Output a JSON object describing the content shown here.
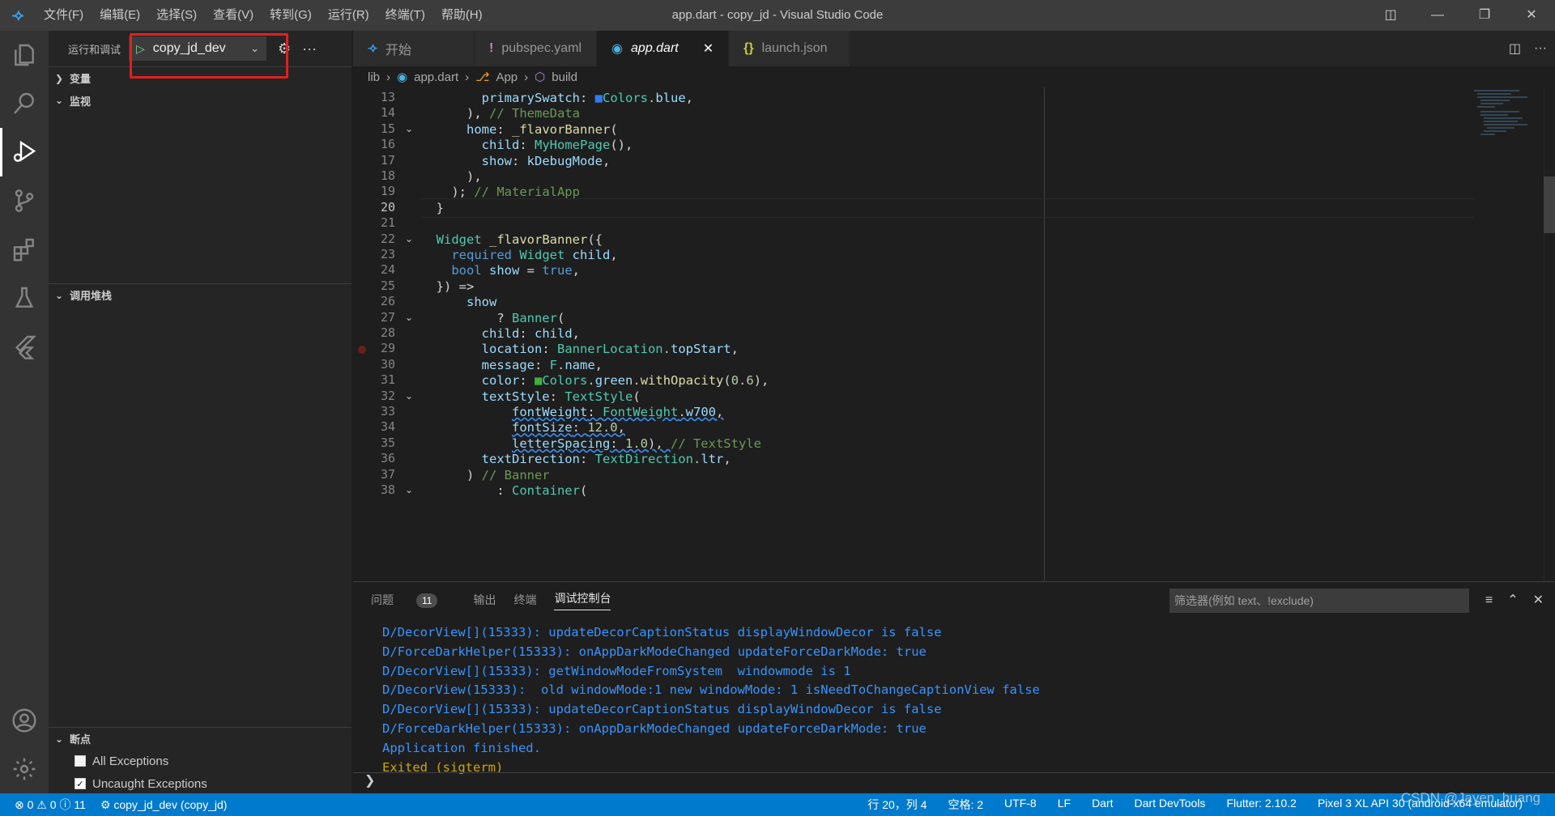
{
  "titlebar": {
    "menu": [
      "文件(F)",
      "编辑(E)",
      "选择(S)",
      "查看(V)",
      "转到(G)",
      "运行(R)",
      "终端(T)",
      "帮助(H)"
    ],
    "title": "app.dart - copy_jd - Visual Studio Code"
  },
  "sidebar": {
    "header": "运行和调试",
    "config": "copy_jd_dev",
    "sections": {
      "variables": "变量",
      "watch": "监视",
      "callstack": "调用堆栈",
      "breakpoints": "断点"
    },
    "exceptions": [
      {
        "label": "All Exceptions",
        "checked": false
      },
      {
        "label": "Uncaught Exceptions",
        "checked": true
      }
    ]
  },
  "tabs": [
    {
      "label": "开始",
      "icon": "vscode-logo-icon"
    },
    {
      "label": "pubspec.yaml",
      "icon": "exclamation-icon"
    },
    {
      "label": "app.dart",
      "icon": "dart-icon",
      "active": true
    },
    {
      "label": "launch.json",
      "icon": "braces-icon"
    }
  ],
  "breadcrumb": [
    "lib",
    "app.dart",
    "App",
    "build"
  ],
  "editor": {
    "current_line": 20,
    "breakpoint_line": 29,
    "lines": [
      {
        "n": 13,
        "segs": [
          [
            "        ",
            ""
          ],
          [
            "primarySwatch",
            ""
          ],
          [
            ": ",
            ""
          ],
          [
            "■",
            "#2f7bf2"
          ],
          [
            "Colors",
            ""
          ],
          [
            ".",
            ""
          ],
          [
            "blue",
            ""
          ],
          [
            ",",
            ""
          ]
        ]
      },
      {
        "n": 14,
        "segs": [
          [
            "      ), ",
            ""
          ],
          [
            "// ThemeData",
            "#6a9955"
          ]
        ]
      },
      {
        "n": 15,
        "segs": [
          [
            "      ",
            ""
          ],
          [
            "home",
            ""
          ],
          [
            ": ",
            ""
          ],
          [
            "_flavorBanner",
            ""
          ],
          [
            "(",
            ""
          ]
        ]
      },
      {
        "n": 16,
        "segs": [
          [
            "        ",
            ""
          ],
          [
            "child",
            ""
          ],
          [
            ": ",
            ""
          ],
          [
            "MyHomePage",
            ""
          ],
          [
            "(),",
            ""
          ]
        ]
      },
      {
        "n": 17,
        "segs": [
          [
            "        ",
            ""
          ],
          [
            "show",
            ""
          ],
          [
            ": ",
            ""
          ],
          [
            "kDebugMode",
            ""
          ],
          [
            ",",
            ""
          ]
        ]
      },
      {
        "n": 18,
        "segs": [
          [
            "      ),",
            ""
          ]
        ]
      },
      {
        "n": 19,
        "segs": [
          [
            "    ); ",
            ""
          ],
          [
            "// MaterialApp",
            "#6a9955"
          ]
        ]
      },
      {
        "n": 20,
        "segs": [
          [
            "  }",
            ""
          ]
        ]
      },
      {
        "n": 21,
        "segs": [
          [
            "",
            ""
          ]
        ]
      },
      {
        "n": 22,
        "segs": [
          [
            "  ",
            ""
          ],
          [
            "Widget",
            ""
          ],
          [
            " ",
            ""
          ],
          [
            "_flavorBanner",
            ""
          ],
          [
            "({",
            ""
          ]
        ]
      },
      {
        "n": 23,
        "segs": [
          [
            "    ",
            ""
          ],
          [
            "required",
            ""
          ],
          [
            " ",
            ""
          ],
          [
            "Widget",
            ""
          ],
          [
            " ",
            ""
          ],
          [
            "child",
            ""
          ],
          [
            ",",
            ""
          ]
        ]
      },
      {
        "n": 24,
        "segs": [
          [
            "    ",
            ""
          ],
          [
            "bool",
            ""
          ],
          [
            " ",
            ""
          ],
          [
            "show",
            ""
          ],
          [
            " = ",
            ""
          ],
          [
            "true",
            ""
          ],
          [
            ",",
            ""
          ]
        ]
      },
      {
        "n": 25,
        "segs": [
          [
            "  }) =>",
            ""
          ]
        ]
      },
      {
        "n": 26,
        "segs": [
          [
            "      ",
            ""
          ],
          [
            "show",
            ""
          ]
        ]
      },
      {
        "n": 27,
        "segs": [
          [
            "          ? ",
            ""
          ],
          [
            "Banner",
            ""
          ],
          [
            "(",
            ""
          ]
        ]
      },
      {
        "n": 28,
        "segs": [
          [
            "        ",
            ""
          ],
          [
            "child",
            ""
          ],
          [
            ": ",
            ""
          ],
          [
            "child",
            ""
          ],
          [
            ",",
            ""
          ]
        ]
      },
      {
        "n": 29,
        "segs": [
          [
            "        ",
            ""
          ],
          [
            "location",
            ""
          ],
          [
            ": ",
            ""
          ],
          [
            "BannerLocation",
            ""
          ],
          [
            ".",
            ""
          ],
          [
            "topStart",
            ""
          ],
          [
            ",",
            ""
          ]
        ]
      },
      {
        "n": 30,
        "segs": [
          [
            "        ",
            ""
          ],
          [
            "message",
            ""
          ],
          [
            ": ",
            ""
          ],
          [
            "F",
            ""
          ],
          [
            ".",
            ""
          ],
          [
            "name",
            ""
          ],
          [
            ",",
            ""
          ]
        ]
      },
      {
        "n": 31,
        "segs": [
          [
            "        ",
            ""
          ],
          [
            "color",
            ""
          ],
          [
            ": ",
            ""
          ],
          [
            "■",
            "#3cb043"
          ],
          [
            "Colors",
            ""
          ],
          [
            ".",
            ""
          ],
          [
            "green",
            ""
          ],
          [
            ".",
            ""
          ],
          [
            "withOpacity",
            ""
          ],
          [
            "(",
            ""
          ],
          [
            "0.6",
            ""
          ],
          [
            "),",
            ""
          ]
        ]
      },
      {
        "n": 32,
        "segs": [
          [
            "        ",
            ""
          ],
          [
            "textStyle",
            ""
          ],
          [
            ": ",
            ""
          ],
          [
            "TextStyle",
            ""
          ],
          [
            "(",
            ""
          ]
        ]
      },
      {
        "n": 33,
        "segs": [
          [
            "            ",
            ""
          ],
          [
            "fontWeight",
            ""
          ],
          [
            ": ",
            ""
          ],
          [
            "FontWeight",
            ""
          ],
          [
            ".",
            ""
          ],
          [
            "w700",
            ""
          ],
          [
            ",",
            ""
          ]
        ]
      },
      {
        "n": 34,
        "segs": [
          [
            "            ",
            ""
          ],
          [
            "fontSize",
            ""
          ],
          [
            ": ",
            ""
          ],
          [
            "12.0",
            ""
          ],
          [
            ",",
            ""
          ]
        ]
      },
      {
        "n": 35,
        "segs": [
          [
            "            ",
            ""
          ],
          [
            "letterSpacing",
            ""
          ],
          [
            ": ",
            ""
          ],
          [
            "1.0",
            ""
          ],
          [
            "), ",
            ""
          ],
          [
            "// TextStyle",
            "#6a9955"
          ]
        ]
      },
      {
        "n": 36,
        "segs": [
          [
            "        ",
            ""
          ],
          [
            "textDirection",
            ""
          ],
          [
            ": ",
            ""
          ],
          [
            "TextDirection",
            ""
          ],
          [
            ".",
            ""
          ],
          [
            "ltr",
            ""
          ],
          [
            ",",
            ""
          ]
        ]
      },
      {
        "n": 37,
        "segs": [
          [
            "      ) ",
            ""
          ],
          [
            "// Banner",
            "#6a9955"
          ]
        ]
      },
      {
        "n": 38,
        "segs": [
          [
            "          : ",
            ""
          ],
          [
            "Container",
            ""
          ],
          [
            "(",
            ""
          ]
        ]
      }
    ],
    "folds": [
      15,
      22,
      27,
      32,
      38
    ]
  },
  "panel": {
    "tabs": [
      "问题",
      "输出",
      "终端",
      "调试控制台"
    ],
    "problems_count": "11",
    "filter_placeholder": "筛选器(例如 text、!exclude)",
    "output": [
      {
        "text": "D/DecorView[](15333): updateDecorCaptionStatus displayWindowDecor is false",
        "color": "#3794ff"
      },
      {
        "text": "D/ForceDarkHelper(15333): onAppDarkModeChanged updateForceDarkMode: true",
        "color": "#3794ff"
      },
      {
        "text": "D/DecorView[](15333): getWindowModeFromSystem  windowmode is 1",
        "color": "#3794ff"
      },
      {
        "text": "D/DecorView(15333):  old windowMode:1 new windowMode: 1 isNeedToChangeCaptionView false",
        "color": "#3794ff"
      },
      {
        "text": "D/DecorView[](15333): updateDecorCaptionStatus displayWindowDecor is false",
        "color": "#3794ff"
      },
      {
        "text": "D/ForceDarkHelper(15333): onAppDarkModeChanged updateForceDarkMode: true",
        "color": "#3794ff"
      },
      {
        "text": "Application finished.",
        "color": "#3794ff"
      },
      {
        "text": "Exited (sigterm)",
        "color": "#cca700"
      }
    ]
  },
  "status": {
    "errors": "0",
    "warnings": "0",
    "infos": "11",
    "debug_target": "copy_jd_dev (copy_jd)",
    "position": "行 20，列 4",
    "spaces": "空格: 2",
    "encoding": "UTF-8",
    "eol": "LF",
    "language": "Dart",
    "devtools": "Dart DevTools",
    "flutter": "Flutter: 2.10.2",
    "device": "Pixel 3 XL API 30 (android-x64 emulator)",
    "watermark": "CSDN @Jayen_huang"
  }
}
